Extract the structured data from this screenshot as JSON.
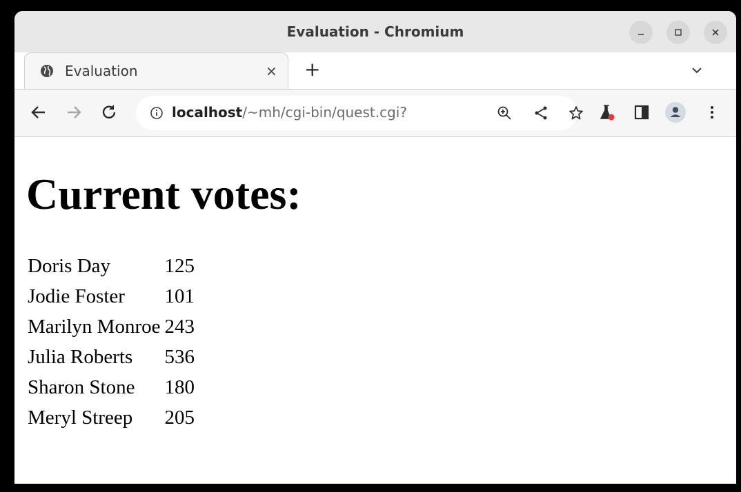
{
  "window": {
    "title": "Evaluation - Chromium",
    "controls": [
      "minimize",
      "maximize",
      "close"
    ]
  },
  "tab": {
    "title": "Evaluation",
    "close_glyph": "×",
    "new_tab_glyph": "+"
  },
  "toolbar": {
    "url_host": "localhost",
    "url_path": "/~mh/cgi-bin/quest.cgi?",
    "icons": [
      "back-icon",
      "forward-icon",
      "reload-icon",
      "info-icon",
      "zoom-icon",
      "share-icon",
      "bookmark-star-icon",
      "labs-flask-icon",
      "side-panel-icon",
      "profile-avatar-icon",
      "menu-kebab-icon"
    ]
  },
  "page": {
    "heading": "Current votes:",
    "rows": [
      {
        "name": "Doris Day",
        "votes": "125"
      },
      {
        "name": "Jodie Foster",
        "votes": "101"
      },
      {
        "name": "Marilyn Monroe",
        "votes": "243"
      },
      {
        "name": "Julia Roberts",
        "votes": "536"
      },
      {
        "name": "Sharon Stone",
        "votes": "180"
      },
      {
        "name": "Meryl Streep",
        "votes": "205"
      }
    ]
  },
  "colors": {
    "titlebar": "#e8e8e8",
    "toolbar": "#f6f6f6",
    "accent_red": "#e53935"
  }
}
